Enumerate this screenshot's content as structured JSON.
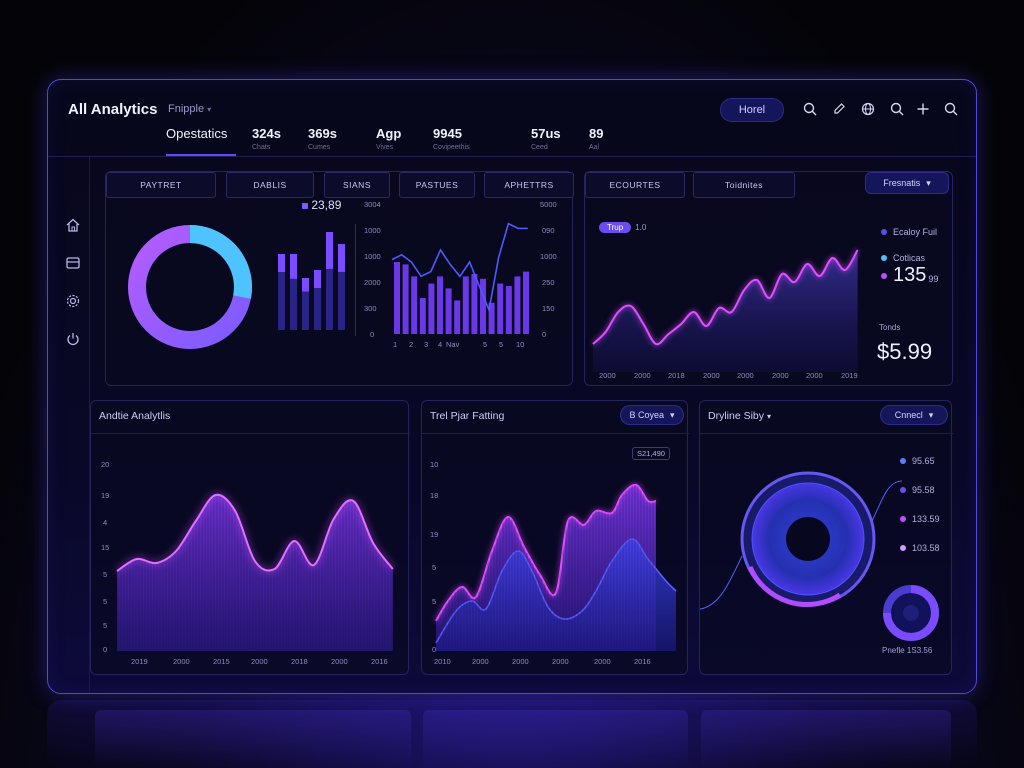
{
  "colors": {
    "accent": "#5b4cf0",
    "magenta": "#d04dff",
    "cyan": "#4fc3ff",
    "violet": "#7a3cff",
    "frame": "#4b4bd6"
  },
  "header": {
    "title": "All Analytics",
    "profile": "Fnipple",
    "stats": [
      {
        "value": "Opestatics",
        "sub": ""
      },
      {
        "value": "324s",
        "sub": "Chats"
      },
      {
        "value": "369s",
        "sub": "Cumes"
      },
      {
        "value": "Agp",
        "sub": "Vives"
      },
      {
        "value": "9945",
        "sub": "Covipeethis"
      },
      {
        "value": "57us",
        "sub": "Ceed"
      },
      {
        "value": "89",
        "sub": "Aal"
      }
    ],
    "button": "Horel",
    "icons": [
      "search-icon",
      "edit-icon",
      "globe-icon",
      "search-icon",
      "add-icon",
      "search-icon"
    ]
  },
  "sidebar": {
    "icons": [
      "home-icon",
      "card-icon",
      "settings-icon",
      "power-icon"
    ]
  },
  "top_left": {
    "tabs": [
      "PAYTRET",
      "DABLIS",
      "SIANS",
      "PASTUES",
      "APHETTRS"
    ],
    "legend_value": "23,89",
    "y_left": [
      "3004",
      "1000",
      "1000",
      "2000",
      "300",
      "0"
    ],
    "y_right": [
      "5000",
      "090",
      "1000",
      "250",
      "150",
      "0"
    ],
    "x_ticks": [
      "1",
      "2",
      "3",
      "4",
      "Nav",
      "5",
      "5",
      "10"
    ],
    "donut": {
      "segments": [
        {
          "label": "cyan",
          "value": 28
        },
        {
          "label": "violet",
          "value": 72
        }
      ]
    }
  },
  "top_right": {
    "tabs": [
      "ECOURTES",
      "Toidnites"
    ],
    "dropdown": "Fresnatis",
    "toggle_label": "Trup",
    "toggle_value": "1.0",
    "legend": [
      {
        "label": "Ecaloy Fuil",
        "color": "#5b4cf0"
      },
      {
        "label": "Cotlicas",
        "color": "#4fc3ff"
      }
    ],
    "big_value": "135",
    "big_suffix": "99",
    "sub_label": "Tonds",
    "price": "$5.99",
    "x_ticks": [
      "2000",
      "2000",
      "2018",
      "2000",
      "2000",
      "2000",
      "2000",
      "2019"
    ]
  },
  "bottom_left": {
    "title": "Andtie Analytlis",
    "y_ticks": [
      "20",
      "19",
      "4",
      "15",
      "5",
      "5",
      "5",
      "0"
    ],
    "x_ticks": [
      "2019",
      "2000",
      "2015",
      "2000",
      "2018",
      "2000",
      "2016"
    ]
  },
  "bottom_mid": {
    "title": "Trel Pjar Fatting",
    "dropdown": "B Coyea",
    "annotation": "S21,490",
    "y_ticks": [
      "10",
      "18",
      "19",
      "5",
      "5",
      "0"
    ],
    "x_ticks": [
      "2010",
      "2000",
      "2000",
      "2000",
      "2000",
      "2016"
    ]
  },
  "bottom_right": {
    "title": "Dryline Siby",
    "dropdown": "Cnnecl",
    "legend": [
      {
        "label": "95.65",
        "color": "#5b7cff"
      },
      {
        "label": "95.58",
        "color": "#6b4cf0"
      },
      {
        "label": "133.59",
        "color": "#c04dff"
      },
      {
        "label": "103.58",
        "color": "#d59cff"
      }
    ],
    "footer": "Pnefle 1S3.56"
  }
}
